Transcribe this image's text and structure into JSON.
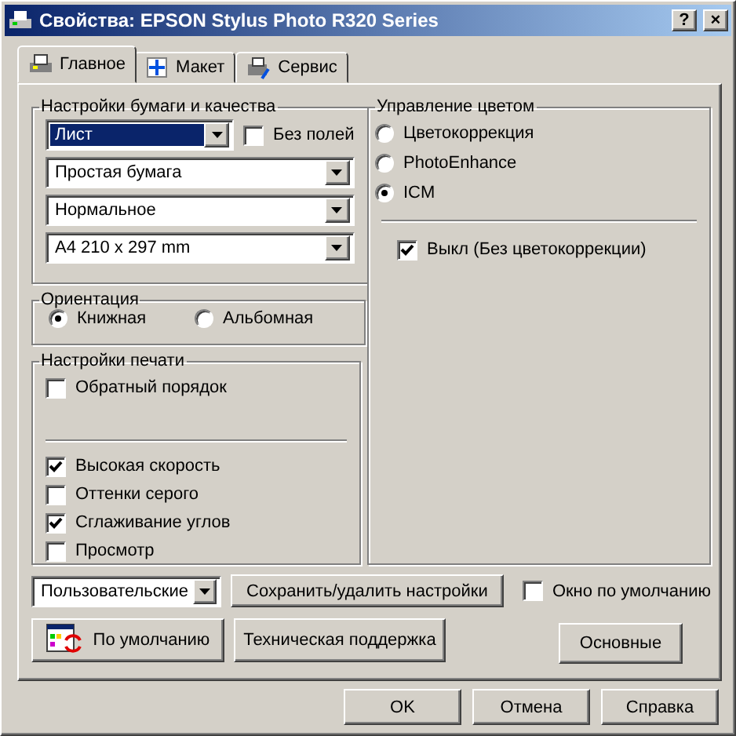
{
  "window": {
    "title": "Свойства: EPSON Stylus Photo R320 Series",
    "title_buttons": [
      "?",
      "×"
    ]
  },
  "tabs": [
    {
      "label": "Главное",
      "selected": true
    },
    {
      "label": "Макет",
      "selected": false
    },
    {
      "label": "Сервис",
      "selected": false
    }
  ],
  "paper_quality": {
    "title": "Настройки бумаги и качества",
    "source": {
      "value": "Лист",
      "focused": true
    },
    "borderless": {
      "label": "Без полей",
      "checked": false
    },
    "selects": [
      {
        "value": "Простая бумага"
      },
      {
        "value": "Нормальное"
      },
      {
        "value": "A4 210 x 297 mm"
      }
    ]
  },
  "orientation": {
    "title": "Ориентация",
    "options": [
      {
        "label": "Книжная",
        "selected": true
      },
      {
        "label": "Альбомная",
        "selected": false
      }
    ]
  },
  "print_settings": {
    "title": "Настройки печати",
    "top": [
      {
        "label": "Обратный порядок",
        "checked": false
      }
    ],
    "bottom": [
      {
        "label": "Высокая скорость",
        "checked": true
      },
      {
        "label": "Оттенки серого",
        "checked": false
      },
      {
        "label": "Сглаживание углов",
        "checked": true
      },
      {
        "label": "Просмотр",
        "checked": false
      }
    ]
  },
  "color_management": {
    "title": "Управление цветом",
    "options": [
      {
        "label": "Цветокоррекция",
        "selected": false
      },
      {
        "label": "PhotoEnhance",
        "selected": false
      },
      {
        "label": "ICM",
        "selected": true
      }
    ],
    "icm_off": {
      "label": "Выкл (Без цветокоррекции)",
      "checked": true
    }
  },
  "presets": {
    "value": "Пользовательские",
    "save_button": "Сохранить/удалить настройки",
    "default_window": {
      "label": "Окно по умолчанию",
      "checked": false
    }
  },
  "panel_buttons": {
    "defaults": "По умолчанию",
    "support": "Техническая поддержка",
    "basic": "Основные"
  },
  "dialog_buttons": [
    "OK",
    "Отмена",
    "Справка"
  ]
}
